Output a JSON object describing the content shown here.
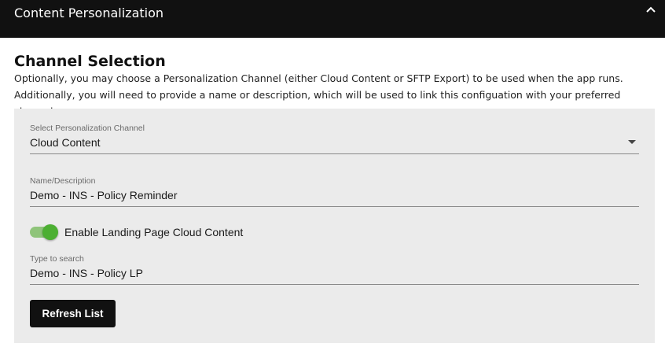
{
  "header": {
    "title": "Content Personalization",
    "collapse_icon": "chevron-up-icon"
  },
  "section": {
    "title": "Channel Selection",
    "description": "Optionally, you may choose a Personalization Channel (either Cloud Content or SFTP Export) to be used when the app runs. Additionally, you will need to provide a name or description, which will be used to link this configuation with your preferred channel."
  },
  "form": {
    "channel": {
      "label": "Select Personalization Channel",
      "value": "Cloud Content"
    },
    "name": {
      "label": "Name/Description",
      "value": "Demo - INS - Policy Reminder"
    },
    "landing_toggle": {
      "label": "Enable Landing Page Cloud Content",
      "checked": true
    },
    "search": {
      "label": "Type to search",
      "value": "Demo - INS - Policy LP"
    },
    "refresh_label": "Refresh List"
  },
  "colors": {
    "header_bg": "#111111",
    "panel_bg": "#ebebeb",
    "toggle_on": "#4caf32",
    "button_bg": "#111111"
  }
}
